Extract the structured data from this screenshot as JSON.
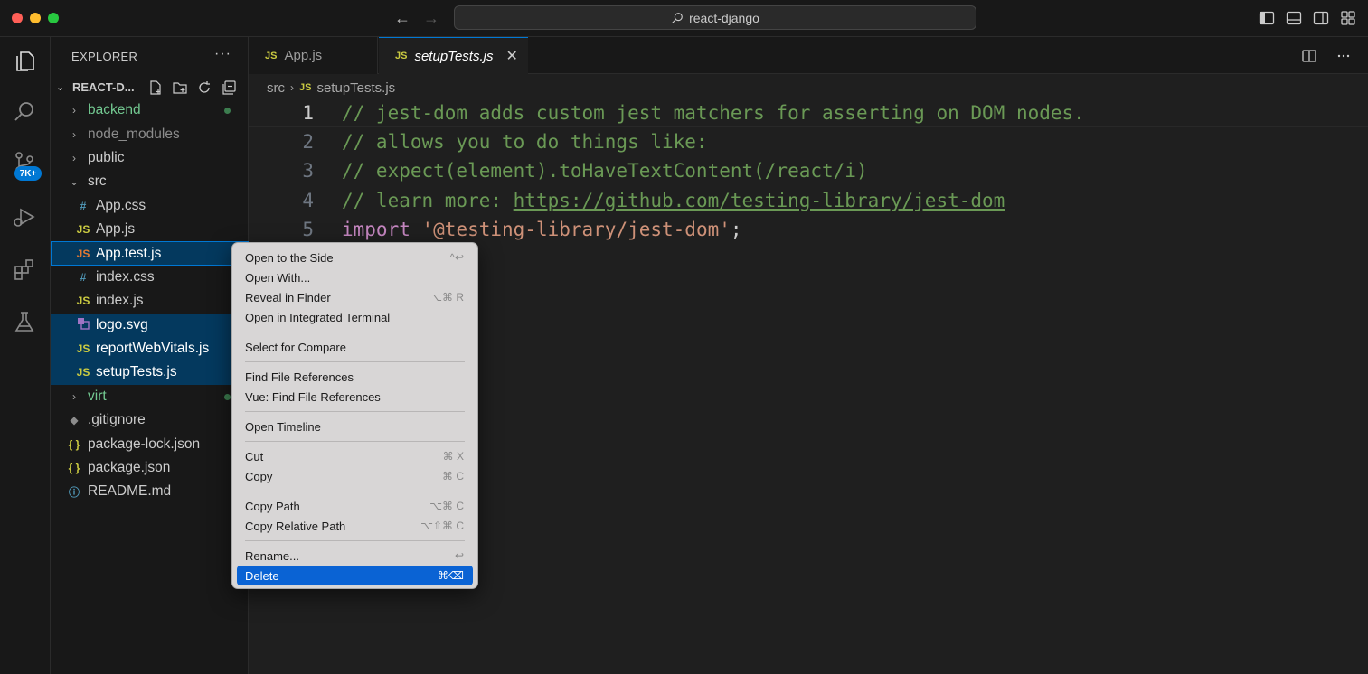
{
  "window": {
    "title": "react-django"
  },
  "activity_bar": {
    "items": [
      "files-icon",
      "search-icon",
      "source-control-icon",
      "run-debug-icon",
      "extensions-icon",
      "testing-icon"
    ],
    "source_control_badge": "7K+"
  },
  "explorer": {
    "header": "EXPLORER",
    "more": "···",
    "root": "REACT-D...",
    "items": [
      {
        "label": "backend"
      },
      {
        "label": "node_modules"
      },
      {
        "label": "public"
      },
      {
        "label": "src"
      },
      {
        "label": "App.css",
        "icon": "#"
      },
      {
        "label": "App.js",
        "icon": "JS"
      },
      {
        "label": "App.test.js",
        "icon": "JS"
      },
      {
        "label": "index.css",
        "icon": "#"
      },
      {
        "label": "index.js",
        "icon": "JS"
      },
      {
        "label": "logo.svg"
      },
      {
        "label": "reportWebVitals.js",
        "icon": "JS"
      },
      {
        "label": "setupTests.js",
        "icon": "JS"
      },
      {
        "label": "virt"
      },
      {
        "label": ".gitignore"
      },
      {
        "label": "package-lock.json",
        "icon": "{ }"
      },
      {
        "label": "package.json",
        "icon": "{ }"
      },
      {
        "label": "README.md"
      }
    ]
  },
  "tabs": [
    {
      "label": "App.js",
      "icon": "JS"
    },
    {
      "label": "setupTests.js",
      "icon": "JS",
      "close": "✕"
    }
  ],
  "breadcrumb": {
    "folder": "src",
    "file": "setupTests.js",
    "file_icon": "JS"
  },
  "code": {
    "lines": [
      {
        "n": "1",
        "text": "// jest-dom adds custom jest matchers for asserting on DOM nodes."
      },
      {
        "n": "2",
        "text": "// allows you to do things like:"
      },
      {
        "n": "3",
        "text": "// expect(element).toHaveTextContent(/react/i)"
      },
      {
        "n": "4",
        "prefix": "// learn more: ",
        "link": "https://github.com/testing-library/jest-dom"
      },
      {
        "n": "5",
        "keyword": "import",
        "string": "'@testing-library/jest-dom'",
        "punct": ";"
      }
    ]
  },
  "context_menu": {
    "items": [
      {
        "label": "Open to the Side",
        "shortcut": "^↩"
      },
      {
        "label": "Open With..."
      },
      {
        "label": "Reveal in Finder",
        "shortcut": "⌥⌘ R"
      },
      {
        "label": "Open in Integrated Terminal"
      },
      {
        "label": "Select for Compare"
      },
      {
        "label": "Find File References"
      },
      {
        "label": "Vue: Find File References"
      },
      {
        "label": "Open Timeline"
      },
      {
        "label": "Cut",
        "shortcut": "⌘ X"
      },
      {
        "label": "Copy",
        "shortcut": "⌘ C"
      },
      {
        "label": "Copy Path",
        "shortcut": "⌥⌘ C"
      },
      {
        "label": "Copy Relative Path",
        "shortcut": "⌥⇧⌘ C"
      },
      {
        "label": "Rename...",
        "shortcut": "↩"
      },
      {
        "label": "Delete",
        "shortcut": "⌘⌫"
      }
    ]
  },
  "colors": {
    "accent": "#0078d4",
    "menu_highlight": "#0a63d4",
    "git_added": "#73c991",
    "comment": "#6a9955",
    "keyword": "#c586c0",
    "string": "#ce9178"
  }
}
